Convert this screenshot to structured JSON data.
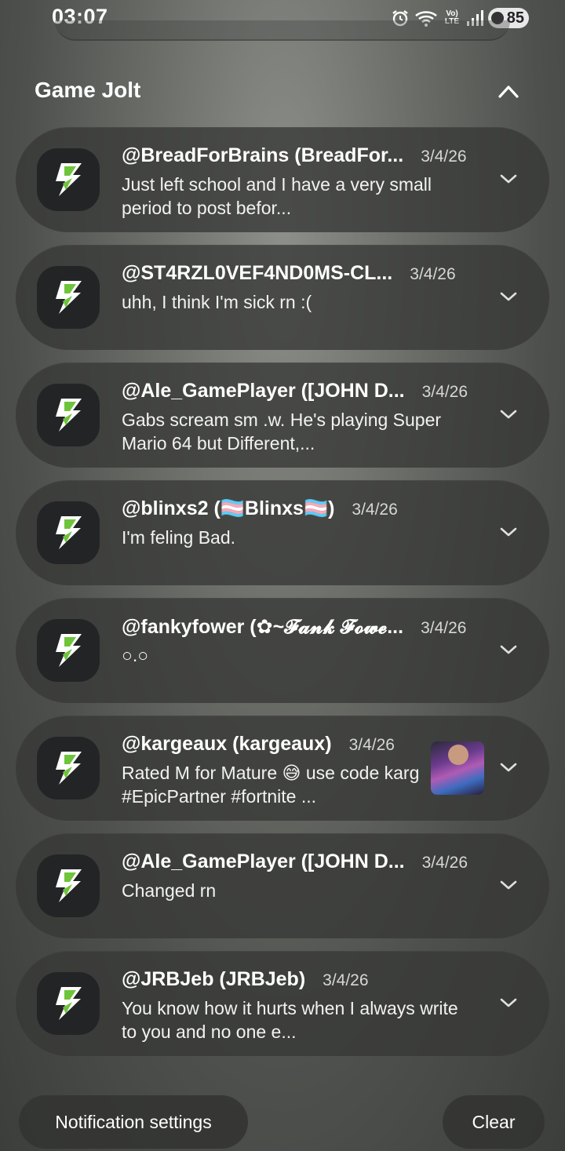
{
  "status_bar": {
    "time": "03:07",
    "network_label": "Vo) LTE",
    "battery_level": "85",
    "icons": [
      "alarm-icon",
      "wifi-icon",
      "volte-icon",
      "signal-icon",
      "battery-icon"
    ]
  },
  "group": {
    "app_name": "Game Jolt"
  },
  "notifications": [
    {
      "title": "@BreadForBrains (BreadFor...",
      "time": "3/4/26",
      "body": "Just left school and I have a very small period to post befor..."
    },
    {
      "title": "@ST4RZL0VEF4ND0MS-CL...",
      "time": "3/4/26",
      "body": "uhh, I think I'm sick rn :("
    },
    {
      "title": "@Ale_GamePlayer ([JOHN D...",
      "time": "3/4/26",
      "body": "Gabs scream sm .w. He's playing Super Mario 64 but Different,..."
    },
    {
      "title": "@blinxs2 (🏳️‍⚧️Blinxs🏳️‍⚧️)",
      "time": "3/4/26",
      "body": "I'm feling Bad."
    },
    {
      "title": "@fankyfower (✿~𝓕𝓪𝓷𝓴 𝓕𝓸𝔀𝓮...",
      "time": "3/4/26",
      "body": "○.○"
    },
    {
      "title": "@kargeaux (kargeaux)",
      "time": "3/4/26",
      "body": "Rated M for Mature 😅 use code karg #EpicPartner #fortnite ..."
    },
    {
      "title": "@Ale_GamePlayer ([JOHN D...",
      "time": "3/4/26",
      "body": "Changed rn"
    },
    {
      "title": "@JRBJeb (JRBJeb)",
      "time": "3/4/26",
      "body": "You know how it hurts when I always write to you and no one e..."
    }
  ],
  "actions": {
    "settings_label": "Notification settings",
    "clear_label": "Clear"
  },
  "colors": {
    "icon_bg": "#232426",
    "bolt_green": "#6ec43a",
    "card_bg": "#383a37"
  }
}
